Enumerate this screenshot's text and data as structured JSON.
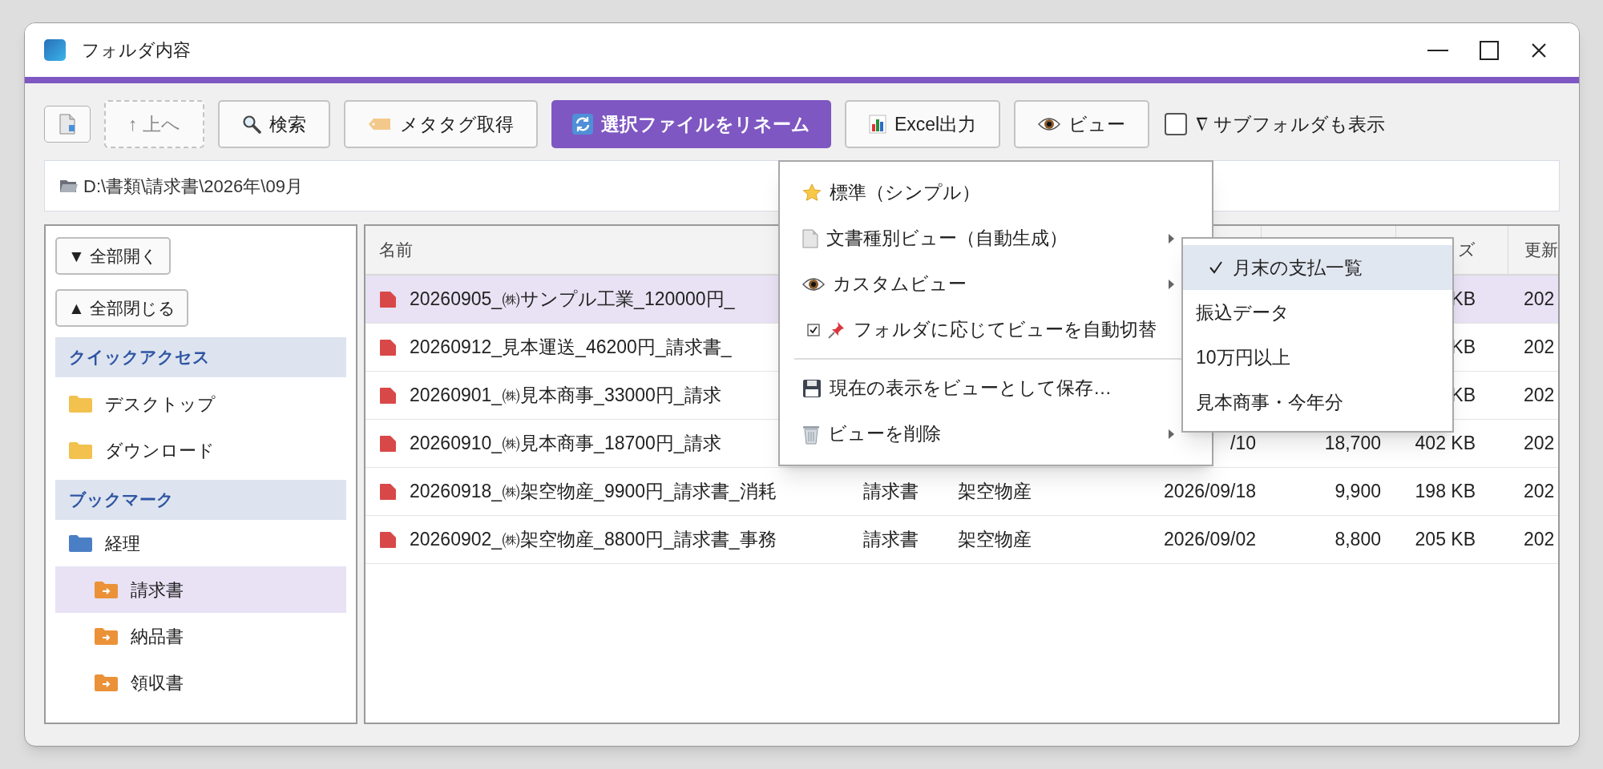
{
  "window": {
    "title": "フォルダ内容"
  },
  "toolbar": {
    "buttons": [
      {
        "kind": "new",
        "disabled": false
      },
      {
        "kind": "up",
        "label": "↑ 上へ",
        "disabled": true
      },
      {
        "kind": "search",
        "label": "検索",
        "disabled": false
      },
      {
        "kind": "tag",
        "label": "メタタグ取得",
        "disabled": false
      },
      {
        "kind": "rename",
        "label": "選択ファイルをリネーム",
        "disabled": false
      },
      {
        "kind": "export",
        "label": "Excel出力",
        "disabled": false
      },
      {
        "kind": "view",
        "label": "ビュー",
        "disabled": false
      }
    ],
    "subfolders": {
      "label": "∇ サブフォルダも表示",
      "checked": false
    }
  },
  "path": "D:\\書類\\請求書\\2026年\\09月",
  "sidebar": {
    "buttons": [
      "▼ 全部開く",
      "▲ 全部閉じる"
    ],
    "sections": [
      {
        "title": "クイックアクセス",
        "items": [
          {
            "label": "デスクトップ",
            "kind": "folder",
            "selected": false
          },
          {
            "label": "ダウンロード",
            "kind": "folder",
            "selected": false
          }
        ]
      },
      {
        "title": "ブックマーク",
        "items": [
          {
            "label": "経理",
            "kind": "group",
            "selected": false,
            "children": [
              {
                "label": "請求書",
                "kind": "link",
                "selected": true
              },
              {
                "label": "納品書",
                "kind": "link",
                "selected": false
              },
              {
                "label": "領収書",
                "kind": "link",
                "selected": false
              }
            ]
          }
        ]
      }
    ]
  },
  "table": {
    "header": {
      "column_1": "名前",
      "column_6": "ズ",
      "column_7": "更新"
    },
    "rows": [
      {
        "selected": true,
        "column_1": "20260905_㈱サンプル工業_120000円_",
        "column_6": "KB",
        "column_7": "202"
      },
      {
        "selected": false,
        "column_1": "20260912_見本運送_46200円_請求書_",
        "column_6": "KB",
        "column_7": "202"
      },
      {
        "selected": false,
        "column_1": "20260901_㈱見本商事_33000円_請求",
        "column_6": "KB",
        "column_7": "202"
      },
      {
        "selected": false,
        "column_1": "20260910_㈱見本商事_18700円_請求",
        "column_4": "/10",
        "column_5": "18,700",
        "column_6": "402 KB",
        "column_7": "202"
      },
      {
        "selected": false,
        "column_1": "20260918_㈱架空物産_9900円_請求書_消耗",
        "column_2": "請求書",
        "column_3": "架空物産",
        "column_4": "2026/09/18",
        "column_5": "9,900",
        "column_6": "198 KB",
        "column_7": "202"
      },
      {
        "selected": false,
        "column_1": "20260902_㈱架空物産_8800円_請求書_事務",
        "column_2": "請求書",
        "column_3": "架空物産",
        "column_4": "2026/09/02",
        "column_5": "8,800",
        "column_6": "205 KB",
        "column_7": "202"
      }
    ]
  },
  "view_menu": {
    "items": [
      {
        "kind": "preset",
        "label": "標準（シンプル）",
        "submenu": false
      },
      {
        "kind": "generated",
        "label": "文書種別ビュー（自動生成）",
        "submenu": true
      },
      {
        "kind": "custom",
        "label": "カスタムビュー",
        "submenu": true
      },
      {
        "kind": "toggle",
        "label": "フォルダに応じてビューを自動切替",
        "submenu": false,
        "checked": true
      },
      {
        "kind": "separator"
      },
      {
        "kind": "save",
        "label": "現在の表示をビューとして保存…",
        "submenu": false
      },
      {
        "kind": "delete",
        "label": "ビューを削除",
        "submenu": true
      }
    ],
    "submenu": [
      {
        "label": "月末の支払一覧",
        "selected": true
      },
      {
        "label": "振込データ",
        "selected": false
      },
      {
        "label": "10万円以上",
        "selected": false
      },
      {
        "label": "見本商事・今年分",
        "selected": false
      }
    ]
  }
}
